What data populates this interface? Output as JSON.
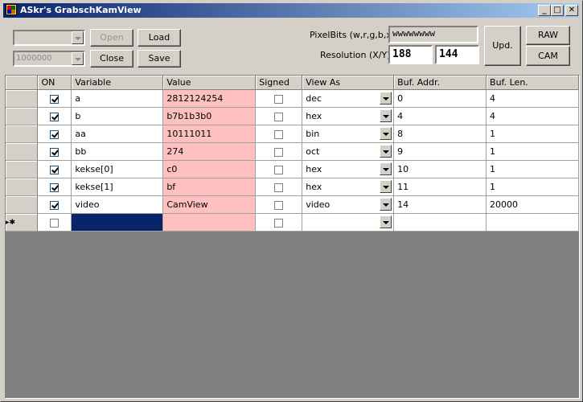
{
  "window": {
    "title": "ASkr's GrabschKamView",
    "min": "_",
    "max": "□",
    "close": "✕"
  },
  "toolbar": {
    "port_value": "",
    "baud_value": "1000000",
    "open_label": "Open",
    "close_label": "Close",
    "load_label": "Load",
    "save_label": "Save",
    "pixelbits_label": "PixelBits (w,r,g,b,x)",
    "pixelbits_value": "wwwwwwww",
    "resolution_label": "Resolution (X/Y)",
    "res_x": "188",
    "res_y": "144",
    "upd_label": "Upd.",
    "raw_label": "RAW",
    "cam_label": "CAM"
  },
  "grid": {
    "columns": [
      "ON",
      "Variable",
      "Value",
      "Signed",
      "View As",
      "Buf. Addr.",
      "Buf. Len."
    ],
    "rows": [
      {
        "on": true,
        "variable": "a",
        "value": "2812124254",
        "signed": false,
        "view": "dec",
        "addr": "0",
        "len": "4"
      },
      {
        "on": true,
        "variable": "b",
        "value": "b7b1b3b0",
        "signed": false,
        "view": "hex",
        "addr": "4",
        "len": "4"
      },
      {
        "on": true,
        "variable": "aa",
        "value": "10111011",
        "signed": false,
        "view": "bin",
        "addr": "8",
        "len": "1"
      },
      {
        "on": true,
        "variable": "bb",
        "value": "274",
        "signed": false,
        "view": "oct",
        "addr": "9",
        "len": "1"
      },
      {
        "on": true,
        "variable": "kekse[0]",
        "value": "c0",
        "signed": false,
        "view": "hex",
        "addr": "10",
        "len": "1"
      },
      {
        "on": true,
        "variable": "kekse[1]",
        "value": "bf",
        "signed": false,
        "view": "hex",
        "addr": "11",
        "len": "1"
      },
      {
        "on": true,
        "variable": "video",
        "value": "CamView",
        "signed": false,
        "view": "video",
        "addr": "14",
        "len": "20000"
      }
    ],
    "new_row_marker": "▸✱"
  }
}
